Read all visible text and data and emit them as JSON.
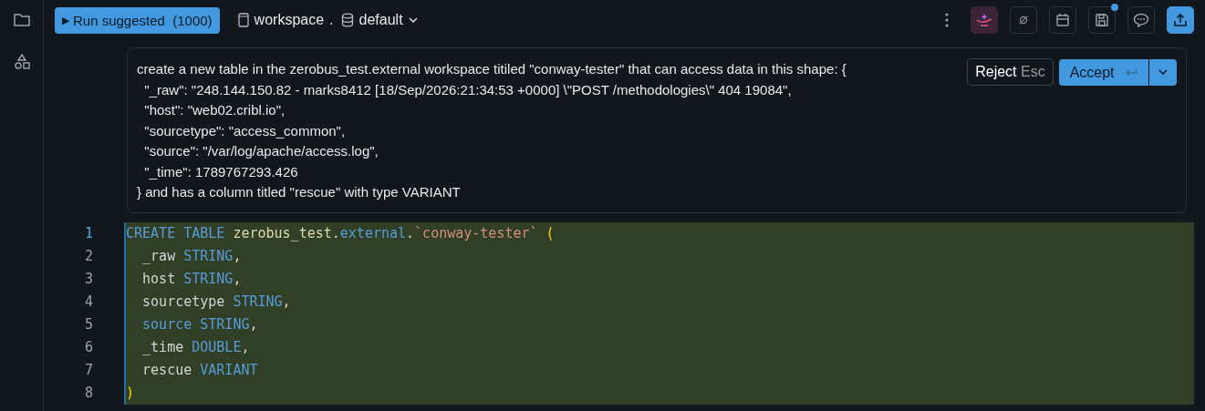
{
  "toolbar": {
    "run_icon": "▶",
    "run_button": "Run suggested",
    "run_limit": "(1000)",
    "catalog": "workspace",
    "separator": ".",
    "schema": "default",
    "save_notification": true
  },
  "prompt": {
    "lines": [
      "create a new table in the zerobus_test.external workspace titiled \"conway-tester\" that can access data in this shape: {",
      "  \"_raw\": \"248.144.150.82 - marks8412 [18/Sep/2026:21:34:53 +0000] \\\"POST /methodologies\\\" 404 19084\",",
      "  \"host\": \"web02.cribl.io\",",
      "  \"sourcetype\": \"access_common\",",
      "  \"source\": \"/var/log/apache/access.log\",",
      "  \"_time\": 1789767293.426",
      "} and has a column titled \"rescue\" with type VARIANT"
    ],
    "reject": "Reject",
    "reject_key": "Esc",
    "accept": "Accept",
    "accept_key": "↩"
  },
  "editor": {
    "lines": [
      {
        "number": "1",
        "tokens": [
          {
            "kind": "kw",
            "text": "CREATE TABLE"
          },
          {
            "kind": "name",
            "text": " zerobus_test"
          },
          {
            "kind": "text",
            "text": "."
          },
          {
            "kind": "kw",
            "text": "external"
          },
          {
            "kind": "text",
            "text": "."
          },
          {
            "kind": "str",
            "text": "`conway-tester`"
          },
          {
            "kind": "paren",
            "text": " ("
          }
        ]
      },
      {
        "number": "2",
        "tokens": [
          {
            "kind": "text",
            "text": "  _raw "
          },
          {
            "kind": "kw",
            "text": "STRING"
          },
          {
            "kind": "text",
            "text": ","
          }
        ]
      },
      {
        "number": "3",
        "tokens": [
          {
            "kind": "text",
            "text": "  host "
          },
          {
            "kind": "kw",
            "text": "STRING"
          },
          {
            "kind": "text",
            "text": ","
          }
        ]
      },
      {
        "number": "4",
        "tokens": [
          {
            "kind": "text",
            "text": "  sourcetype "
          },
          {
            "kind": "kw",
            "text": "STRING"
          },
          {
            "kind": "text",
            "text": ","
          }
        ]
      },
      {
        "number": "5",
        "tokens": [
          {
            "kind": "kw",
            "text": "  source STRING"
          },
          {
            "kind": "text",
            "text": ","
          }
        ]
      },
      {
        "number": "6",
        "tokens": [
          {
            "kind": "text",
            "text": "  _time "
          },
          {
            "kind": "kw",
            "text": "DOUBLE"
          },
          {
            "kind": "text",
            "text": ","
          }
        ]
      },
      {
        "number": "7",
        "tokens": [
          {
            "kind": "text",
            "text": "  rescue "
          },
          {
            "kind": "kw",
            "text": "VARIANT"
          }
        ]
      },
      {
        "number": "8",
        "tokens": [
          {
            "kind": "paren",
            "text": ")"
          }
        ]
      }
    ]
  }
}
